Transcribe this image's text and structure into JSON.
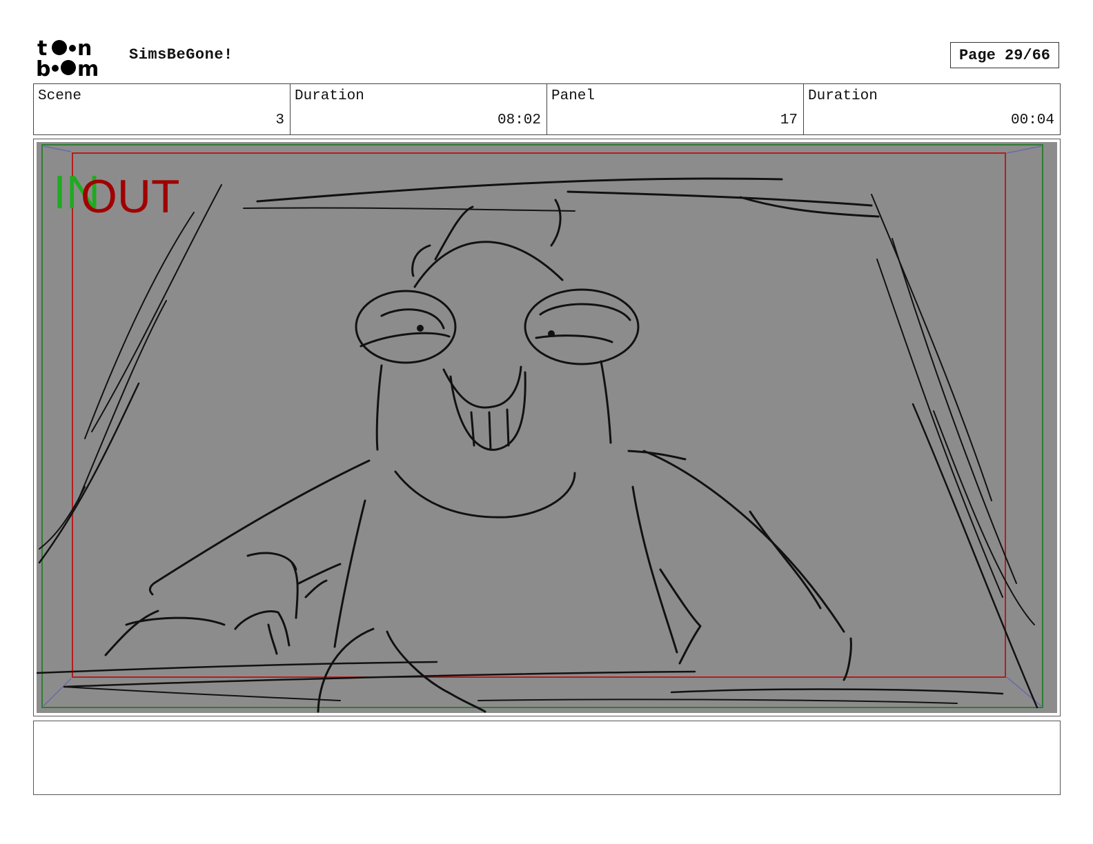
{
  "header": {
    "logo_text": "toon boom",
    "project_title": "SimsBeGone!",
    "page_label": "Page 29/66"
  },
  "info": {
    "scene_label": "Scene",
    "scene_value": "3",
    "scene_duration_label": "Duration",
    "scene_duration_value": "08:02",
    "panel_label": "Panel",
    "panel_value": "17",
    "panel_duration_label": "Duration",
    "panel_duration_value": "00:04"
  },
  "panel": {
    "in_marker": "IN",
    "out_marker": "OUT",
    "background_color": "#8c8c8c",
    "safe_frame_color": "#2e7d32",
    "camera_frame_color": "#b71c1c"
  },
  "notes": {
    "text": ""
  }
}
